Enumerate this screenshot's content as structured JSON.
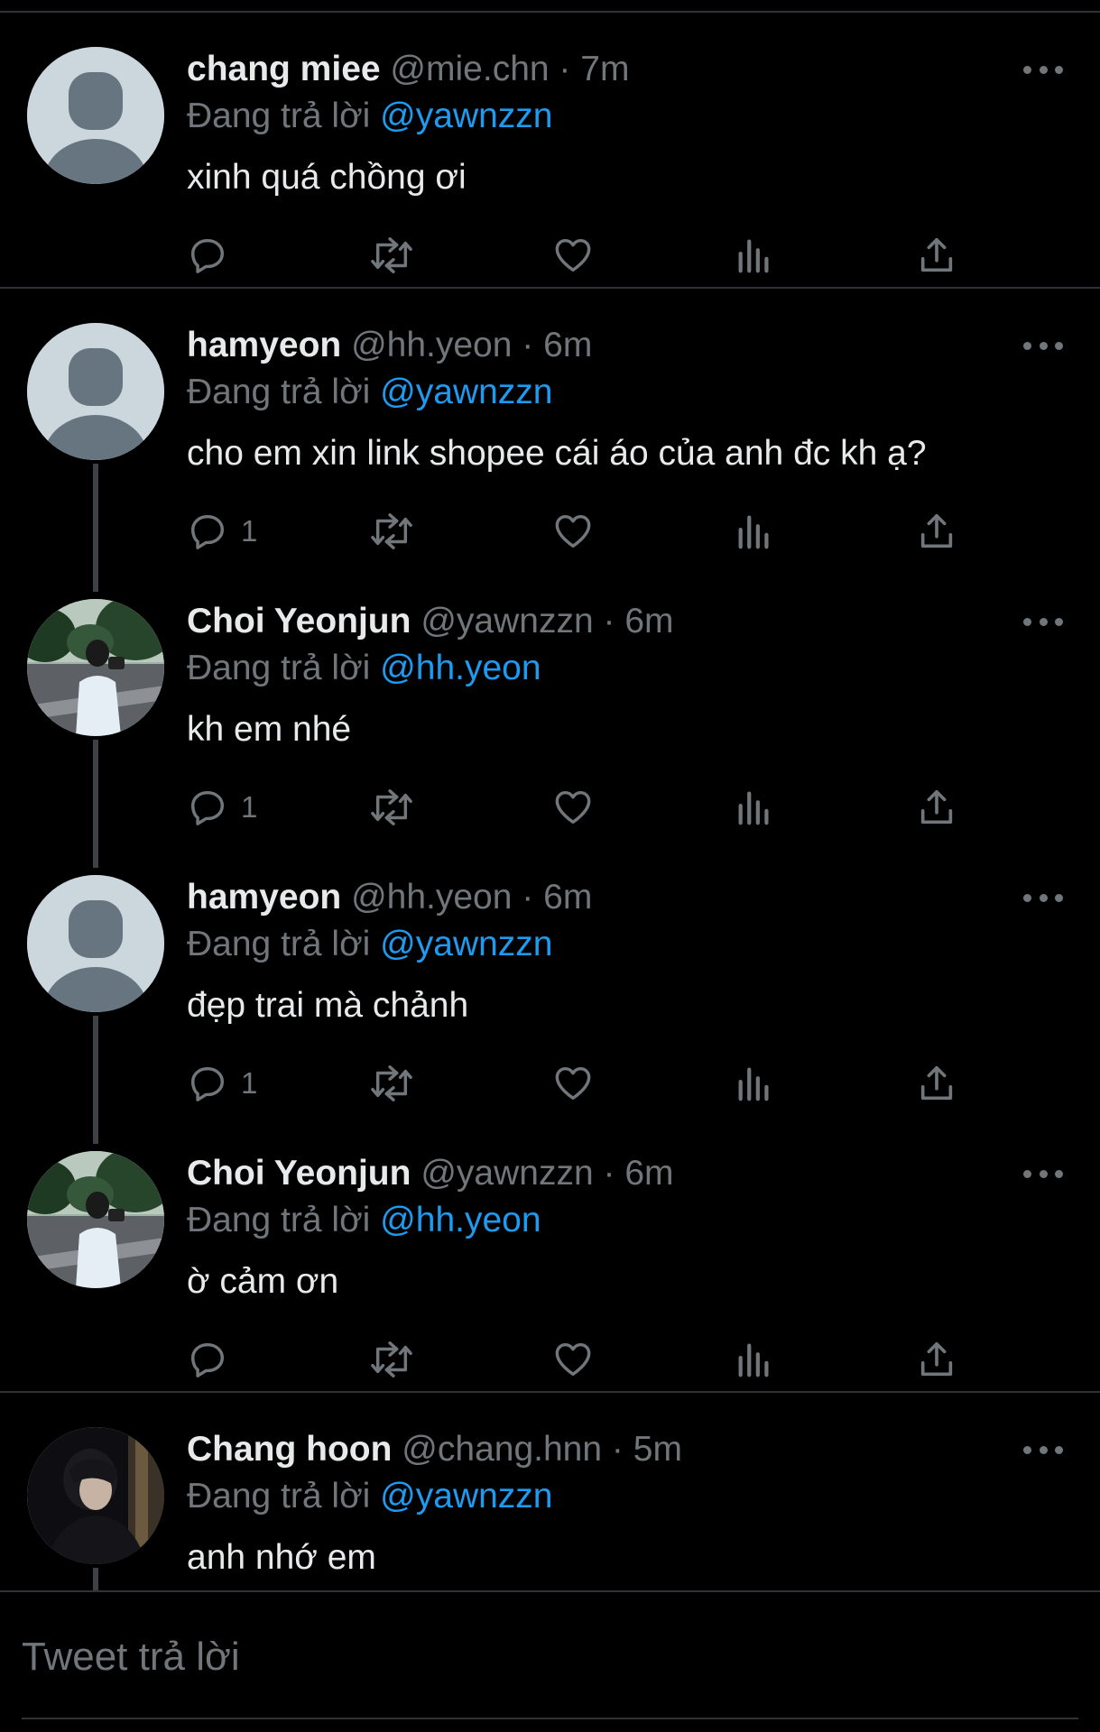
{
  "tweets": [
    {
      "name": "chang miee",
      "handle": "@mie.chn",
      "time": "7m",
      "reply_label": "Đang trả lời",
      "reply_to": "@yawnzzn",
      "text": "xinh quá chồng ơi",
      "reply_count": "",
      "avatar": "default"
    },
    {
      "name": "hamyeon",
      "handle": "@hh.yeon",
      "time": "6m",
      "reply_label": "Đang trả lời",
      "reply_to": "@yawnzzn",
      "text": "cho em xin link shopee cái áo của anh đc kh ạ?",
      "reply_count": "1",
      "avatar": "default"
    },
    {
      "name": "Choi Yeonjun",
      "handle": "@yawnzzn",
      "time": "6m",
      "reply_label": "Đang trả lời",
      "reply_to": "@hh.yeon",
      "text": "kh em nhé",
      "reply_count": "1",
      "avatar": "photo-park"
    },
    {
      "name": "hamyeon",
      "handle": "@hh.yeon",
      "time": "6m",
      "reply_label": "Đang trả lời",
      "reply_to": "@yawnzzn",
      "text": "đẹp trai mà chảnh",
      "reply_count": "1",
      "avatar": "default"
    },
    {
      "name": "Choi Yeonjun",
      "handle": "@yawnzzn",
      "time": "6m",
      "reply_label": "Đang trả lời",
      "reply_to": "@hh.yeon",
      "text": "ờ cảm ơn",
      "reply_count": "",
      "avatar": "photo-park"
    },
    {
      "name": "Chang hoon",
      "handle": "@chang.hnn",
      "time": "5m",
      "reply_label": "Đang trả lời",
      "reply_to": "@yawnzzn",
      "text": "anh nhớ em",
      "reply_count": "",
      "avatar": "photo-dark"
    }
  ],
  "compose": {
    "placeholder": "Tweet trả lời"
  },
  "colors": {
    "background": "#000000",
    "text": "#e7e9ea",
    "muted": "#71767b",
    "accent": "#1d9bf0",
    "divider": "#2f3336"
  },
  "icons": [
    "reply-icon",
    "retweet-icon",
    "like-icon",
    "analytics-icon",
    "share-icon",
    "more-icon"
  ]
}
